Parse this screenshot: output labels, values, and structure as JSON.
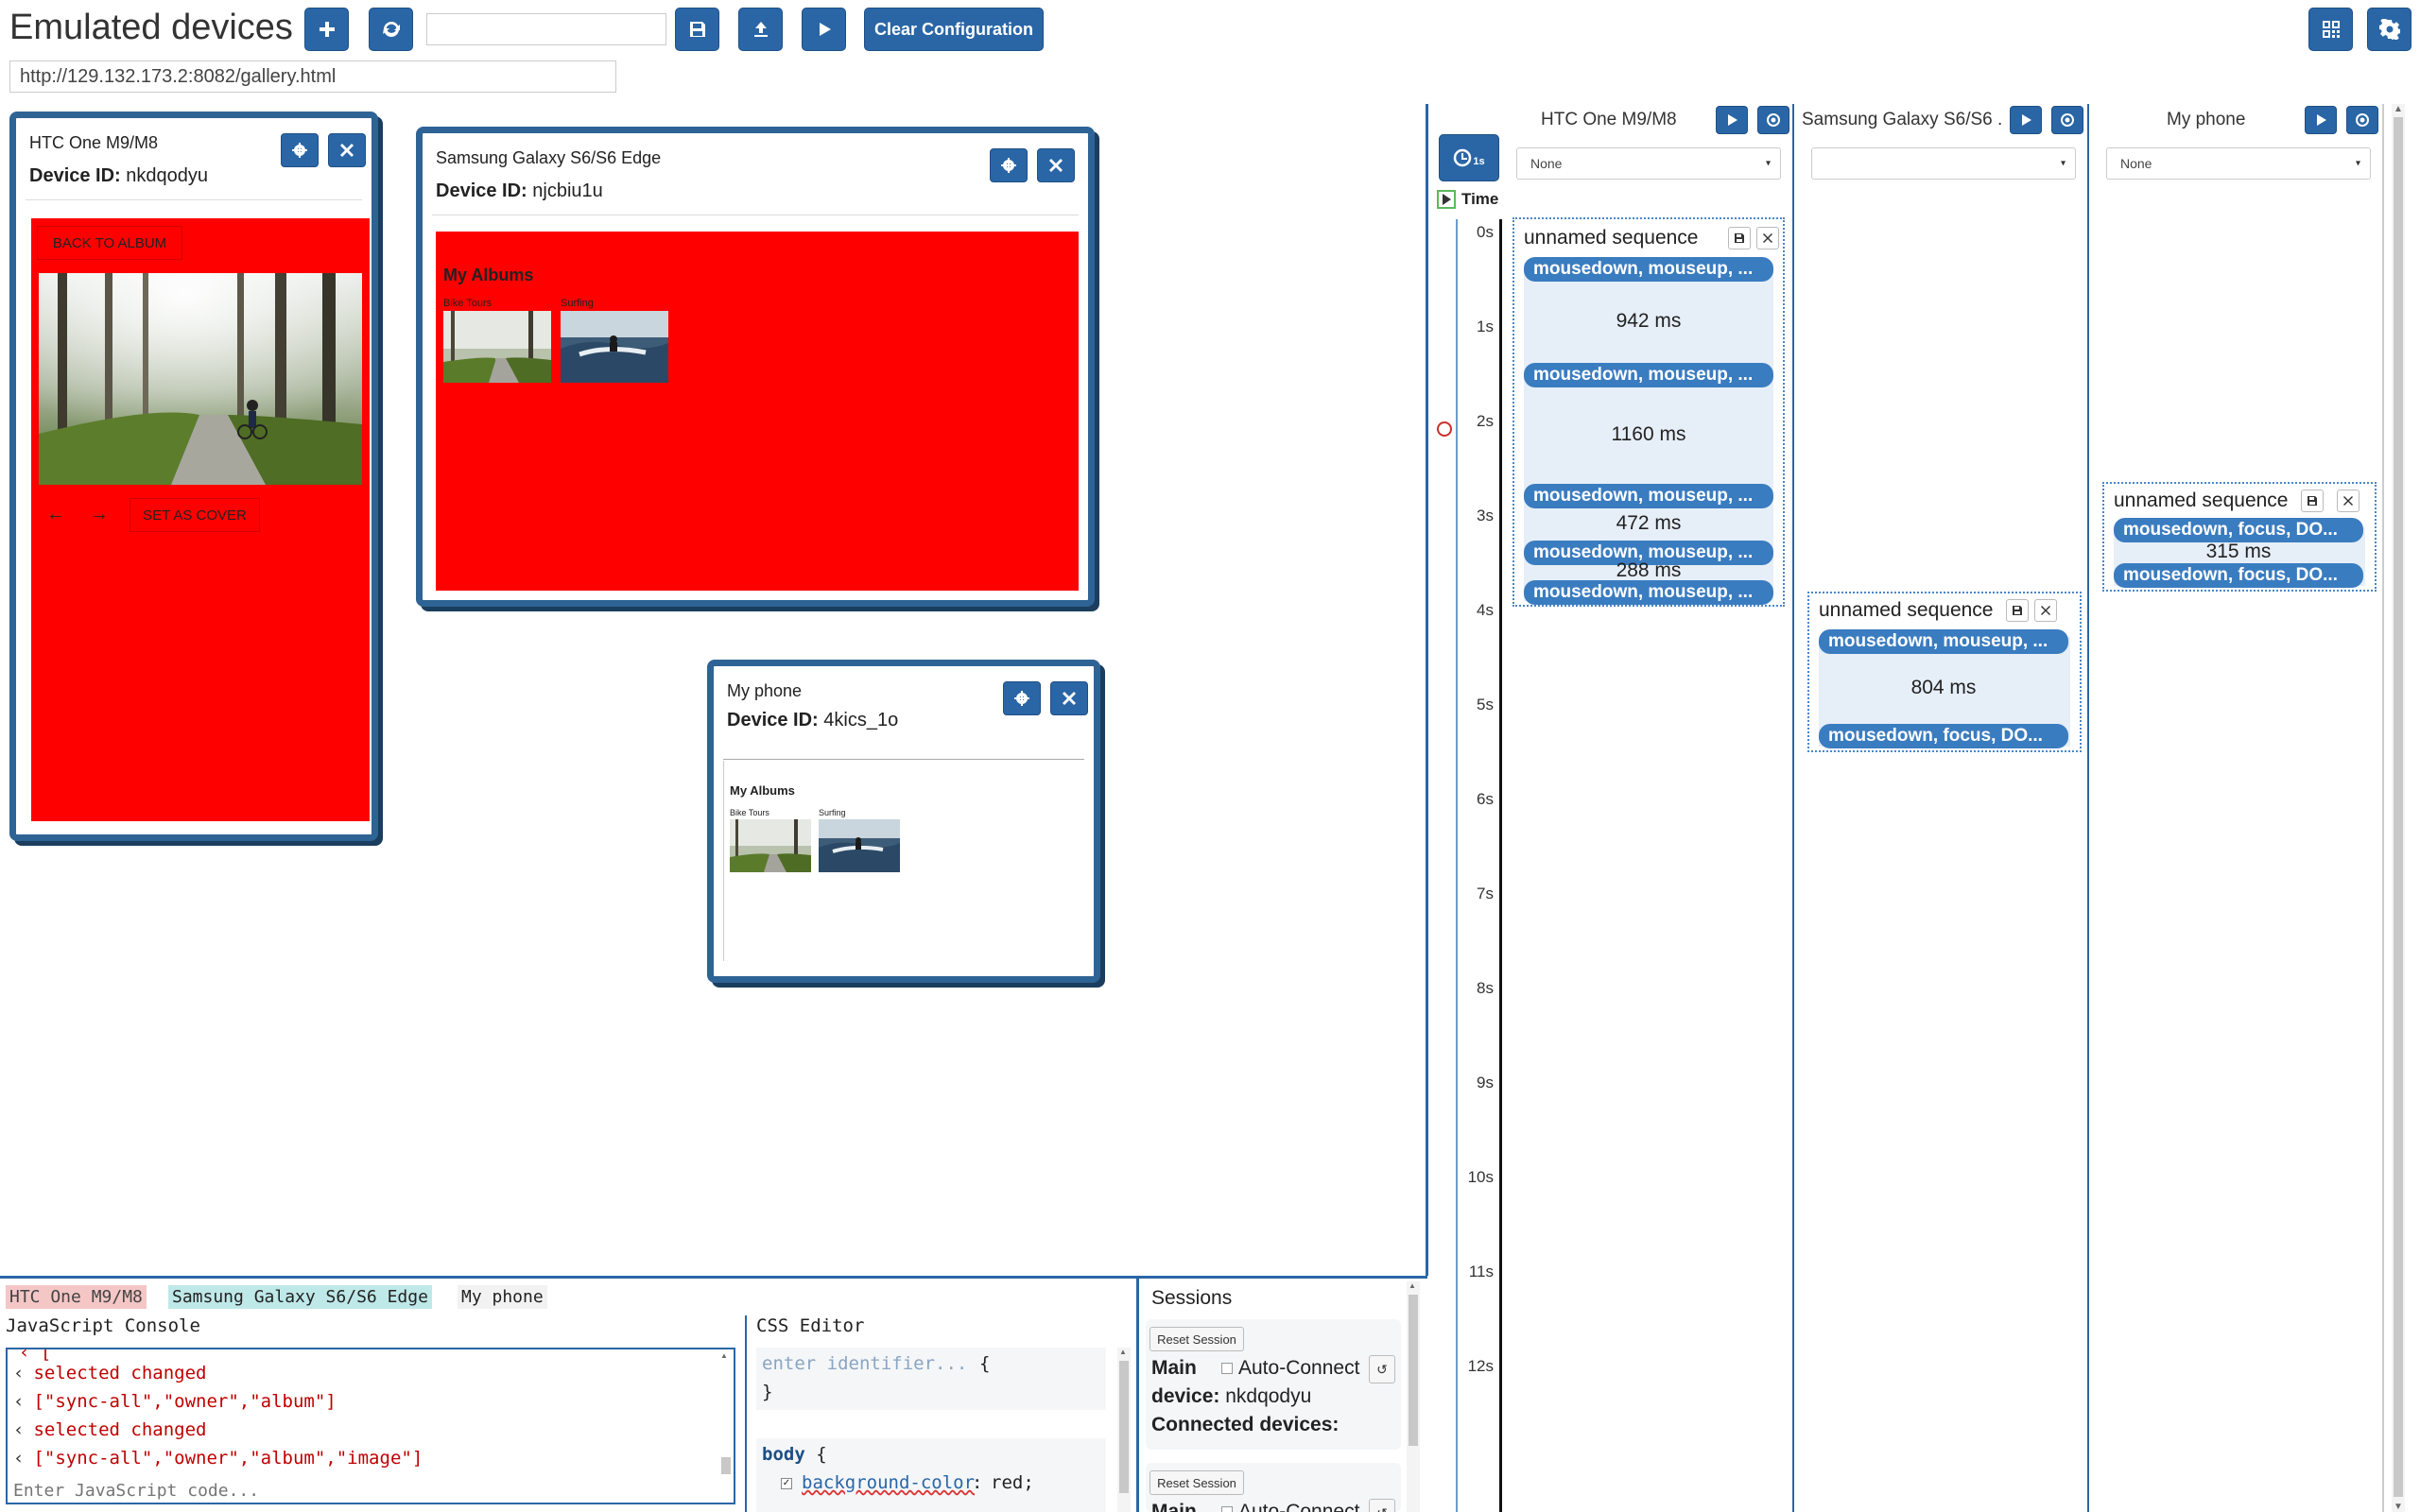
{
  "app": {
    "title": "Emulated devices",
    "url": "http://129.132.173.2:8082/gallery.html",
    "config_name": "",
    "clear_label": "Clear Configuration",
    "accent": "#2a66a6"
  },
  "devices": [
    {
      "name": "HTC One M9/M8",
      "id_label": "Device ID:",
      "id": "nkdqodyu",
      "back_label": "BACK TO ALBUM",
      "cover_label": "SET AS COVER",
      "screen_color": "#ff0000"
    },
    {
      "name": "Samsung Galaxy S6/S6 Edge",
      "id_label": "Device ID:",
      "id": "njcbiu1u",
      "albums_title": "My Albums",
      "albums": [
        "Bike Tours",
        "Surfing"
      ],
      "screen_color": "#ff0000"
    },
    {
      "name": "My phone",
      "id_label": "Device ID:",
      "id": "4kics_1o",
      "albums_title": "My Albums",
      "albums": [
        "Bike Tours",
        "Surfing"
      ],
      "screen_color": "#ffffff"
    }
  ],
  "timeline": {
    "speed_label": "1s",
    "time_label": "Time",
    "ticks": [
      "0s",
      "1s",
      "2s",
      "3s",
      "4s",
      "5s",
      "6s",
      "7s",
      "8s",
      "9s",
      "10s",
      "11s",
      "12s"
    ],
    "columns": [
      {
        "name": "HTC One M9/M8",
        "select_value": "None",
        "sequence": {
          "title": "unnamed sequence",
          "events": [
            "mousedown, mouseup, ...",
            "mousedown, mouseup, ...",
            "mousedown, mouseup, ...",
            "mousedown, mouseup, ...",
            "mousedown, mouseup, ..."
          ],
          "gaps": [
            "942 ms",
            "1160 ms",
            "472 ms",
            "288 ms"
          ]
        }
      },
      {
        "name": "Samsung Galaxy S6/S6 ...",
        "select_value": "",
        "sequence": {
          "title": "unnamed sequence",
          "events": [
            "mousedown, mouseup, ...",
            "mousedown, focus, DO..."
          ],
          "gaps": [
            "804 ms"
          ]
        }
      },
      {
        "name": "My phone",
        "select_value": "None",
        "sequence": {
          "title": "unnamed sequence",
          "events": [
            "mousedown, focus, DO...",
            "mousedown, focus, DO..."
          ],
          "gaps": [
            "315 ms"
          ]
        }
      }
    ]
  },
  "console": {
    "device_tabs": [
      "HTC One M9/M8",
      "Samsung Galaxy S6/S6 Edge",
      "My phone"
    ],
    "device_tab_colors": [
      "#f5c6c6",
      "#bfe8e8",
      "#f2f2f2"
    ],
    "title": "JavaScript Console",
    "lines": [
      "selected changed",
      "[\"sync-all\",\"owner\",\"album\"]",
      "selected changed",
      "[\"sync-all\",\"owner\",\"album\",\"image\"]"
    ],
    "placeholder": "Enter JavaScript code..."
  },
  "css_editor": {
    "title": "CSS Editor",
    "identifier_placeholder": "enter identifier...",
    "open_brace": "{",
    "close_brace": "}",
    "rule_selector": "body",
    "rule_property": "background-color",
    "rule_value": "red;"
  },
  "sessions": {
    "title": "Sessions",
    "reset_label": "Reset Session",
    "main_label": "Main",
    "auto_connect_label": "Auto-Connect",
    "device_label": "device:",
    "device_value": "nkdqodyu",
    "connected_label": "Connected devices:"
  }
}
